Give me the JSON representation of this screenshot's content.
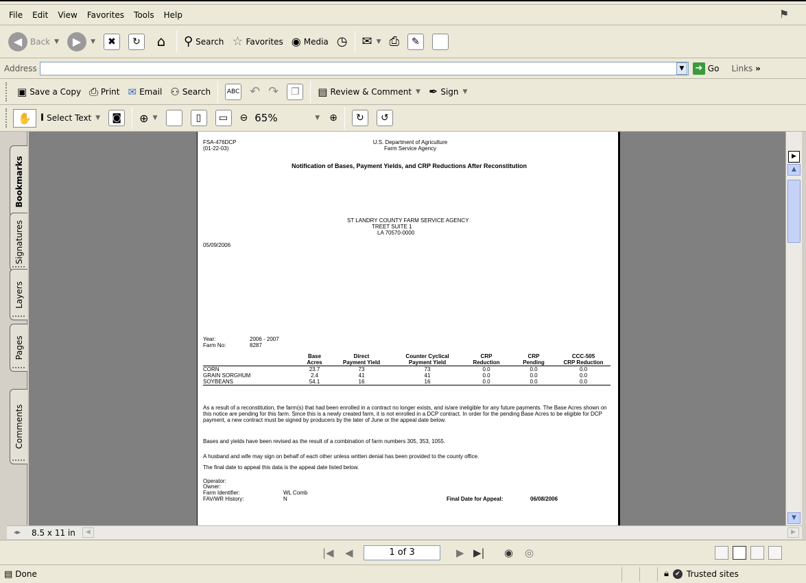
{
  "menu": [
    "File",
    "Edit",
    "View",
    "Favorites",
    "Tools",
    "Help"
  ],
  "std_toolbar": {
    "back": "Back",
    "search": "Search",
    "favorites": "Favorites",
    "media": "Media"
  },
  "address": {
    "label": "Address",
    "value": "",
    "go": "Go",
    "links": "Links"
  },
  "pdf_toolbar1": {
    "save_copy": "Save a Copy",
    "print": "Print",
    "email": "Email",
    "search": "Search",
    "review": "Review & Comment",
    "sign": "Sign"
  },
  "pdf_toolbar2": {
    "select_text": "Select Text",
    "zoom": "65%"
  },
  "nav_tabs": [
    "Bookmarks",
    "Signatures",
    "Layers",
    "Pages",
    "Comments"
  ],
  "document": {
    "form_id": "FSA-476DCP",
    "form_date": "(01-22-03)",
    "dept": "U.S. Department of Agriculture",
    "agency": "Farm Service Agency",
    "title": "Notification of Bases, Payment Yields, and CRP Reductions After Reconstitution",
    "office_name": "ST LANDRY COUNTY FARM SERVICE AGENCY",
    "office_street": "TREET SUITE 1",
    "office_city": "LA 70570-0000",
    "date": "05/09/2006",
    "year_label": "Year:",
    "year_value": "2006  -  2007",
    "farm_label": "Farm No:",
    "farm_value": "8287",
    "table": {
      "headers": [
        [
          "",
          "Base",
          "Direct",
          "Counter Cyclical",
          "CRP",
          "CRP",
          "CCC-505"
        ],
        [
          "",
          "Acres",
          "Payment Yield",
          "Payment Yield",
          "Reduction",
          "Pending",
          "CRP Reduction"
        ]
      ],
      "rows": [
        [
          "CORN",
          "23.7",
          "73",
          "73",
          "0.0",
          "0.0",
          "0.0"
        ],
        [
          "GRAIN SORGHUM",
          "2.4",
          "41",
          "41",
          "0.0",
          "0.0",
          "0.0"
        ],
        [
          "SOYBEANS",
          "54.1",
          "16",
          "16",
          "0.0",
          "0.0",
          "0.0"
        ]
      ]
    },
    "para1": "As a result of a reconstitution, the farm(s) that had been enrolled in a contract no longer exists, and is/are ineligible for any future payments.  The Base Acres shown on this notice are pending for this farm.  Since this is a newly created farm, it is not enrolled in a DCP contract.  In order for the pending Base Acres to be eligible for DCP payment, a new contract must be signed by producers by the later of June or the appeal date below.",
    "para2": "Bases and yields have been revised as the result of a combination of farm numbers 305, 353, 1055.",
    "para3": "A husband and wife may sign on behalf of each other unless written denial has been provided to the county office.",
    "para4": "The final date to appeal this data is the appeal date listed below.",
    "operator_label": "Operator:",
    "owner_label": "Owner:",
    "farm_id_label": "Farm Identifier:",
    "farm_id_value": "WL Comb",
    "history_label": "FAV/WR History:",
    "history_value": "N",
    "appeal_label": "Final Date for Appeal:",
    "appeal_value": "06/08/2006"
  },
  "page_size": "8.5 x 11 in",
  "page_counter": "1 of 3",
  "status": {
    "done": "Done",
    "zone": "Trusted sites"
  }
}
